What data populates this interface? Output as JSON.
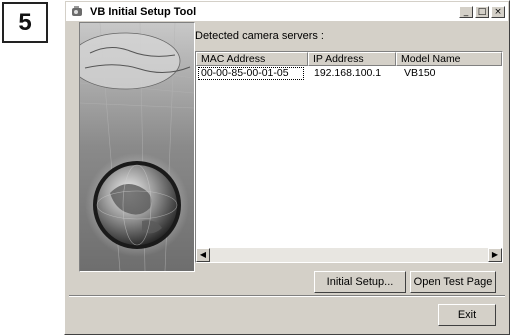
{
  "step": {
    "number": "5"
  },
  "window": {
    "title": "VB Initial Setup Tool",
    "controls": {
      "minimize": "_",
      "maximize": "□",
      "close": "×"
    }
  },
  "main": {
    "detected_label": "Detected camera servers :",
    "list": {
      "columns": [
        "MAC Address",
        "IP Address",
        "Model Name"
      ],
      "rows": [
        {
          "mac": "00-00-85-00-01-05",
          "ip": "192.168.100.1",
          "model": "VB150"
        }
      ]
    },
    "scroll": {
      "left": "◀",
      "right": "▶"
    }
  },
  "buttons": {
    "initial_setup": "Initial Setup...",
    "open_test_page": "Open Test Page",
    "exit": "Exit"
  },
  "icons": {
    "app": "camera-icon",
    "minimize": "minimize-icon",
    "maximize": "maximize-icon",
    "close": "close-icon"
  }
}
